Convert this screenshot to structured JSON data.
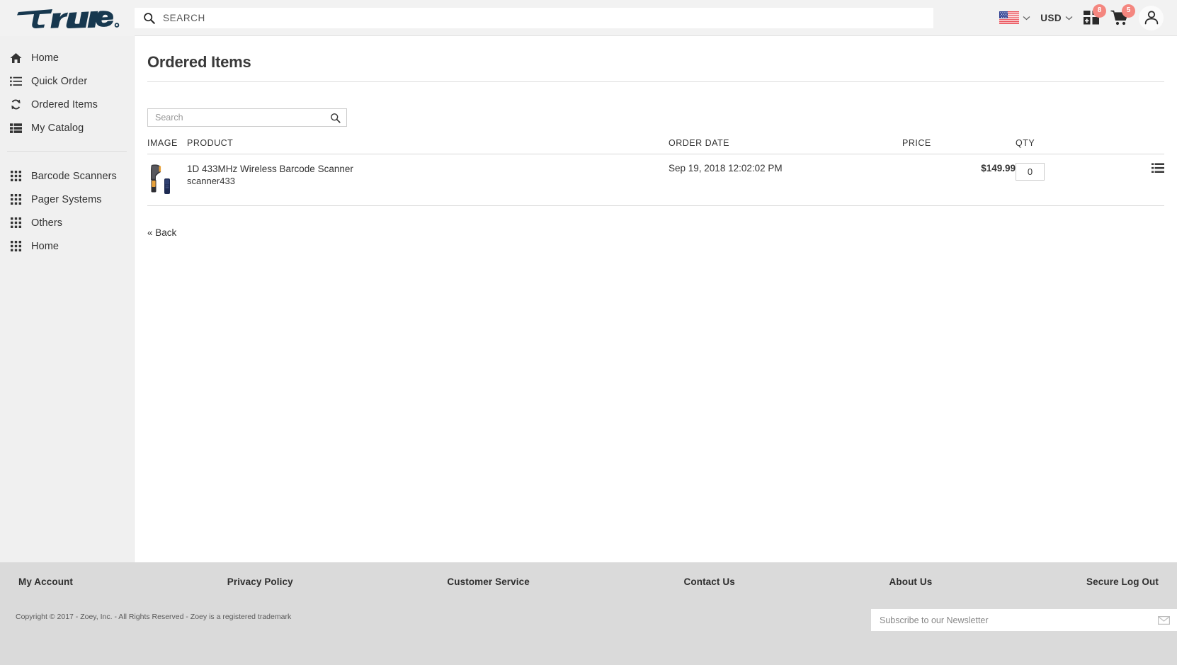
{
  "header": {
    "logo_text": "true",
    "search": {
      "placeholder": "SEARCH",
      "value": "",
      "icon": "search-icon"
    },
    "locale": {
      "flag": "us-flag-icon",
      "chevron": "chevron-down-icon"
    },
    "currency": {
      "label": "USD",
      "chevron": "chevron-down-icon"
    },
    "quote": {
      "icon": "quote-list-icon",
      "badge": "8"
    },
    "cart": {
      "icon": "shopping-cart-icon",
      "badge": "5"
    },
    "account": {
      "icon": "user-account-icon"
    }
  },
  "sidebar": {
    "primary": [
      {
        "label": "Home",
        "icon": "home-icon"
      },
      {
        "label": "Quick Order",
        "icon": "list-icon"
      },
      {
        "label": "Ordered Items",
        "icon": "refresh-cycle-icon"
      },
      {
        "label": "My Catalog",
        "icon": "catalog-list-icon"
      }
    ],
    "categories": [
      {
        "label": "Barcode Scanners",
        "icon": "grid-icon"
      },
      {
        "label": "Pager Systems",
        "icon": "grid-icon"
      },
      {
        "label": "Others",
        "icon": "grid-icon"
      },
      {
        "label": "Home",
        "icon": "grid-icon"
      }
    ]
  },
  "main": {
    "title": "Ordered Items",
    "search": {
      "placeholder": "Search",
      "value": "",
      "icon": "search-icon"
    },
    "table": {
      "columns": [
        "IMAGE",
        "PRODUCT",
        "ORDER DATE",
        "PRICE",
        "QTY"
      ],
      "rows": [
        {
          "image_alt": "barcode-scanner-thumbnail",
          "product_name": "1D 433MHz Wireless Barcode Scanner",
          "product_sku": "scanner433",
          "order_date": "Sep 19, 2018 12:02:02 PM",
          "price": "$149.99",
          "qty": "0",
          "action_icon": "list-options-icon"
        }
      ]
    },
    "back_link": "« Back"
  },
  "footer": {
    "links": [
      "My Account",
      "Privacy Policy",
      "Customer Service",
      "Contact Us",
      "About Us",
      "Secure Log Out"
    ],
    "copyright": "Copyright © 2017 - Zoey, Inc. - All Rights Reserved - Zoey is a registered trademark",
    "newsletter": {
      "placeholder": "Subscribe to our Newsletter",
      "value": "",
      "icon": "envelope-icon"
    }
  },
  "colors": {
    "logo_navy": "#17384f",
    "badge_red": "#f4867f",
    "sidebar_bg": "#f0f0f0",
    "footer_bg": "#dadada",
    "header_bg": "#f2f2f2"
  }
}
